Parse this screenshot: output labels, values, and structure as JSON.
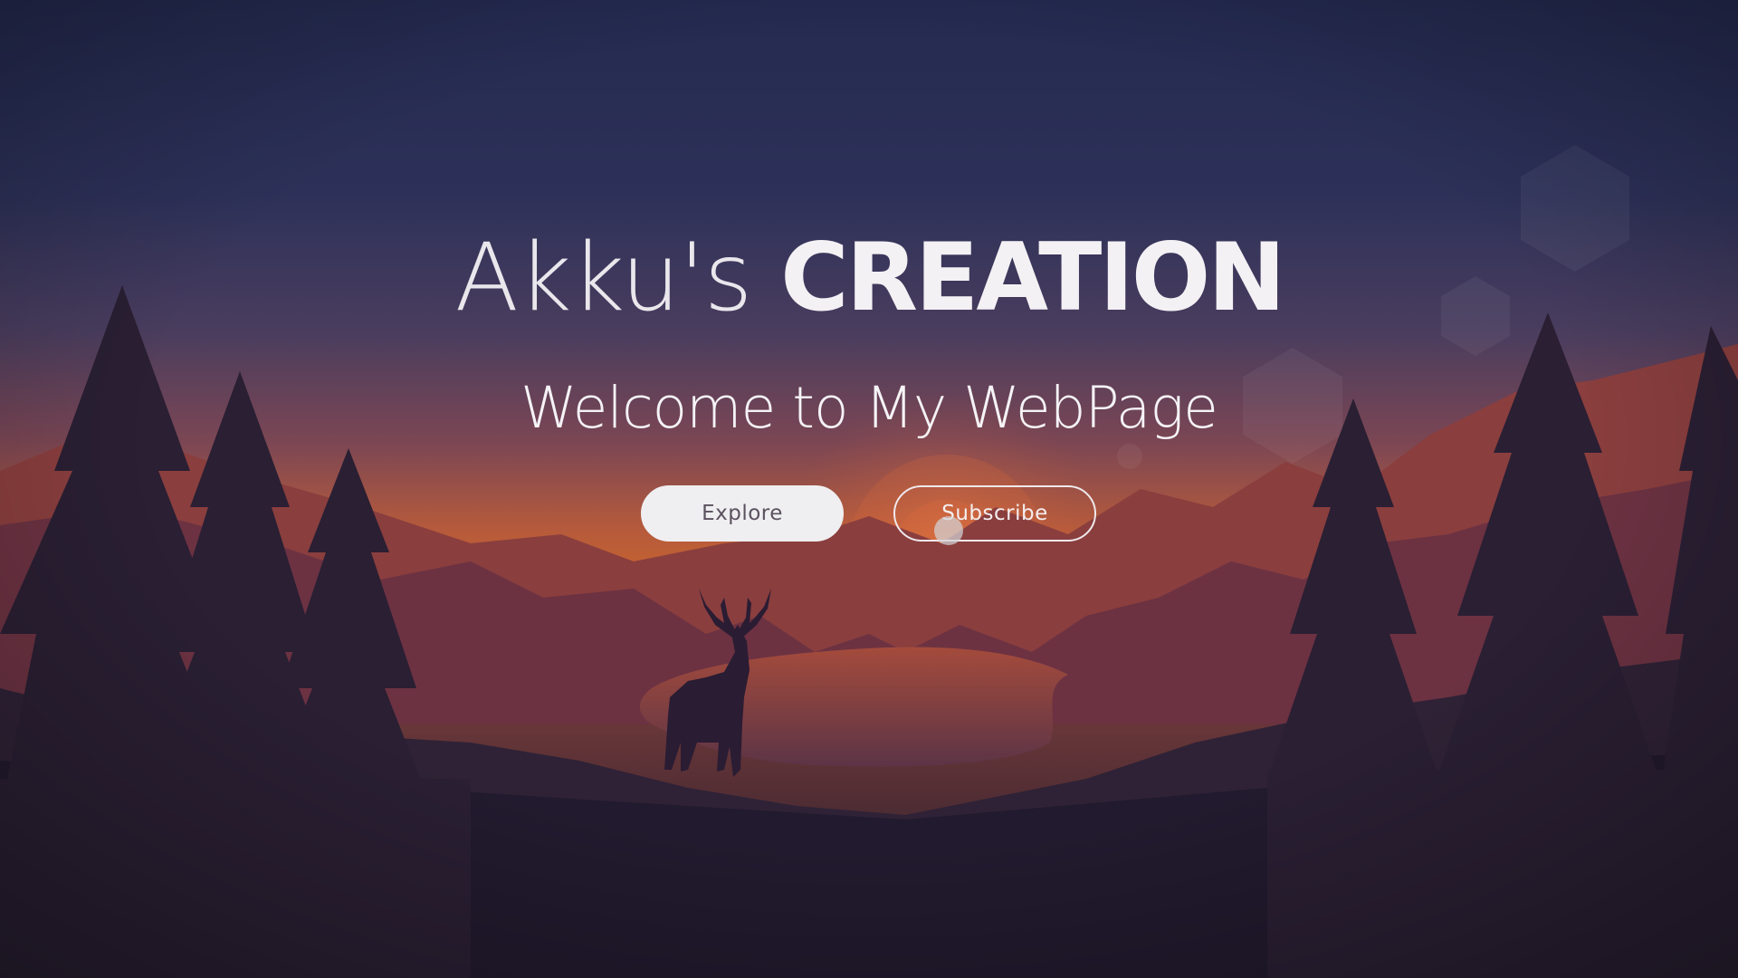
{
  "hero": {
    "title_light": "Akku's",
    "title_bold": "CREATION",
    "subtitle": "Welcome to My WebPage"
  },
  "buttons": {
    "explore_label": "Explore",
    "subscribe_label": "Subscribe"
  },
  "colors": {
    "sky_top": "#262b52",
    "sky_bottom": "#c5552a",
    "foreground": "#1b1729",
    "button_fill": "#efeef0"
  }
}
